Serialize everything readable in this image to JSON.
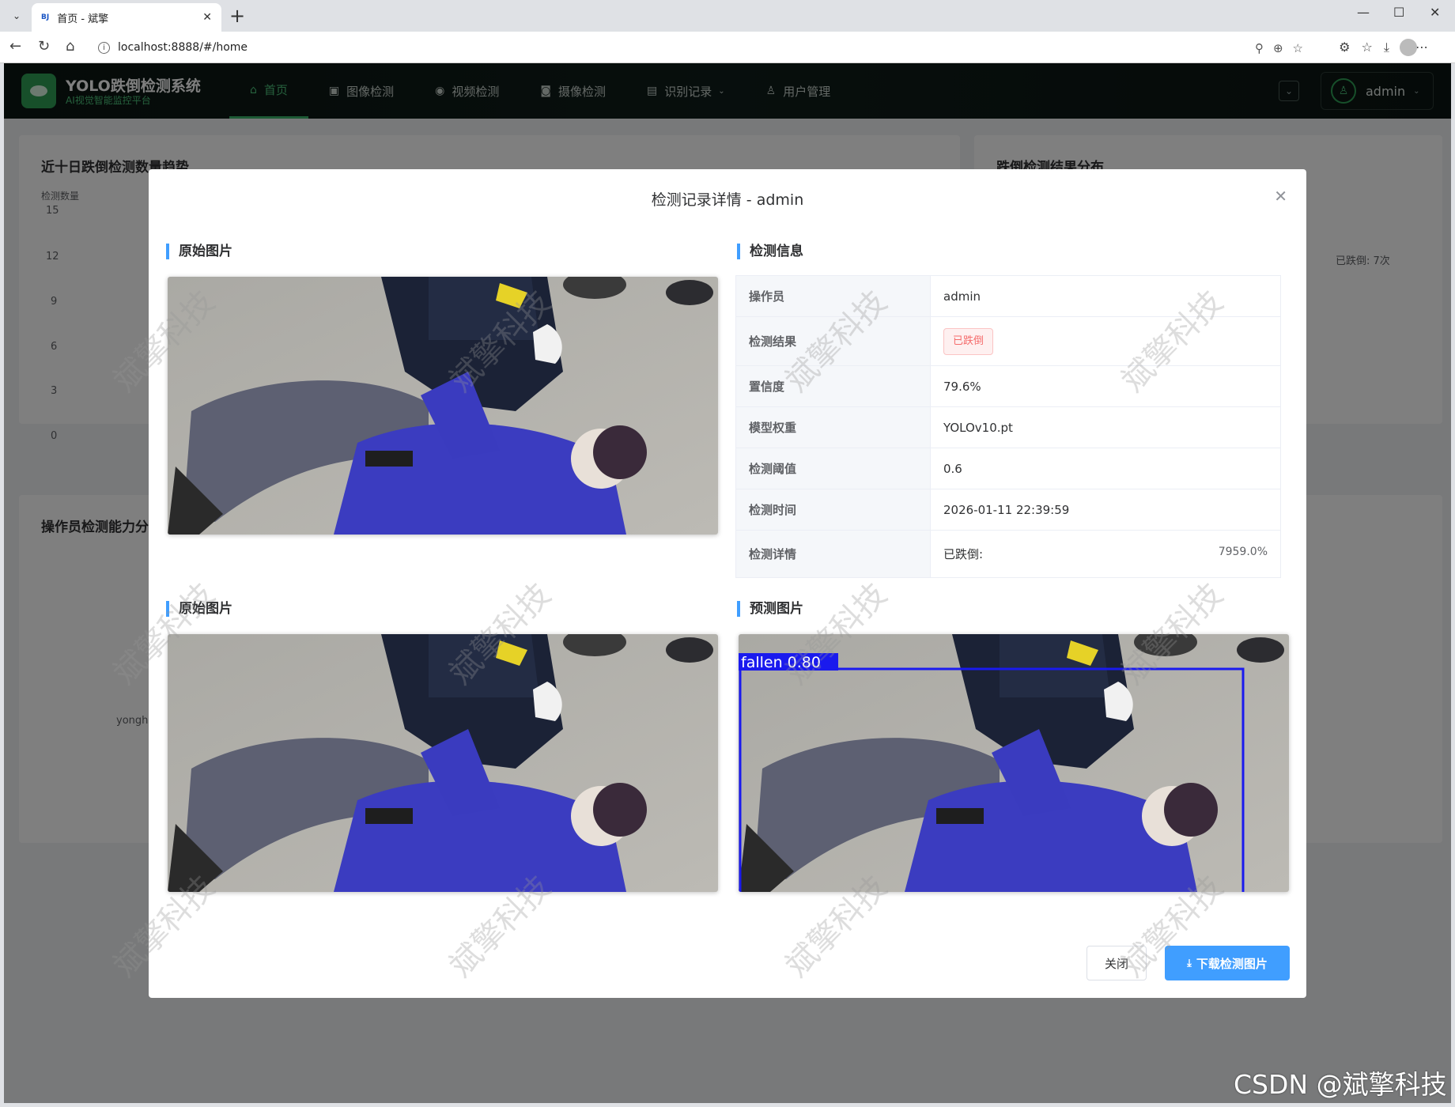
{
  "browser": {
    "tab_title": "首页 - 斌擎",
    "favicon_text": "BJ",
    "url": "localhost:8888/#/home"
  },
  "app": {
    "brand_title": "YOLO跌倒检测系统",
    "brand_subtitle": "AI视觉智能监控平台",
    "menu": [
      {
        "label": "首页",
        "icon": "home-icon",
        "glyph": "⌂"
      },
      {
        "label": "图像检测",
        "icon": "image-icon",
        "glyph": "▣"
      },
      {
        "label": "视频检测",
        "icon": "play-circle-icon",
        "glyph": "◉"
      },
      {
        "label": "摄像检测",
        "icon": "camera-icon",
        "glyph": "◙"
      },
      {
        "label": "识别记录",
        "icon": "document-icon",
        "glyph": "▤"
      },
      {
        "label": "用户管理",
        "icon": "user-icon",
        "glyph": "♙"
      }
    ],
    "user": "admin"
  },
  "dashboard": {
    "trend_title": "近十日跌倒检测数量趋势",
    "trend_ylabel": "检测数量",
    "trend_yticks": [
      "15",
      "12",
      "9",
      "6",
      "3",
      "0"
    ],
    "pie_title": "跌倒检测结果分布",
    "pie_label": "已跌倒: 7次",
    "operator_title": "操作员检测能力分析",
    "operator_label": "yonghu"
  },
  "modal": {
    "title": "检测记录详情 - admin",
    "original_title": "原始图片",
    "info_title": "检测信息",
    "original_title_2": "原始图片",
    "predicted_title": "预测图片",
    "info": {
      "operator_label": "操作员",
      "operator": "admin",
      "result_label": "检测结果",
      "result": "已跌倒",
      "confidence_label": "置信度",
      "confidence": "79.6%",
      "weights_label": "模型权重",
      "weights": "YOLOv10.pt",
      "threshold_label": "检测阈值",
      "threshold": "0.6",
      "time_label": "检测时间",
      "time": "2026-01-11 22:39:59",
      "detail_label": "检测详情",
      "detail": "已跌倒:",
      "detail_pct": "7959.0%"
    },
    "bbox_label": "fallen 0.80",
    "close_button": "关闭",
    "download_button": "下载检测图片"
  },
  "watermark": "斌擎科技",
  "csdn_mark": "CSDN @斌擎科技",
  "colors": {
    "accent": "#409eff",
    "brand_green": "#3bb56b",
    "danger": "#f56c6c",
    "bbox": "#1a1aee"
  }
}
